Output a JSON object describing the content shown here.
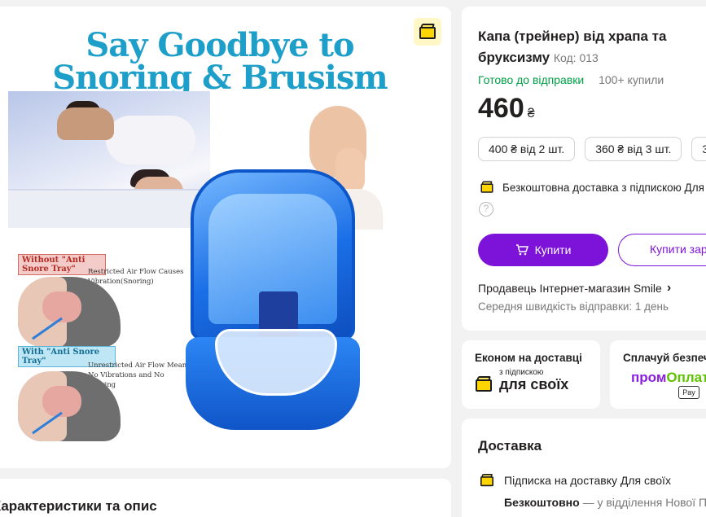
{
  "gallery": {
    "headline_line1": "Say Goodbye to",
    "headline_line2": "Snoring & Brusism",
    "diagram": {
      "without_label": "Without \"Anti Snore Tray\"",
      "without_text": "Restricted Air Flow Causes Vibration(Snoring)",
      "with_label": "With \"Anti Snore Tray\"",
      "with_text": "Unrestricted Air Flow Means No Vibrations and No Snoring"
    },
    "badge_icon": "box-icon"
  },
  "description": {
    "title": "Характеристики та опис"
  },
  "product": {
    "title": "Капа (трейнер) від храпа та бруксизму",
    "code": "Код: 013",
    "stock_status": "Готово до відправки",
    "bought": "100+ купили",
    "price": "460",
    "currency": "₴",
    "tiers": [
      "400 ₴ від 2 шт.",
      "360 ₴ від 3 шт.",
      "3"
    ],
    "free_shipping": "Безкоштовна доставка з підпискою Для своїх",
    "help_symbol": "?",
    "buy_label": "Купити",
    "buy_later_label": "Купити зараз",
    "seller": "Продавець Інтернет-магазин Smile",
    "avg_speed": "Середня швидкість відправки: 1 день"
  },
  "promo": {
    "econom_title": "Економ на доставці",
    "econom_sub": "з підпискою",
    "econom_brand": "для своїх",
    "pay_title": "Сплачуй безпечно",
    "pay_brand_part1": "пром",
    "pay_brand_part2": "Оплата",
    "applepay": "Pay"
  },
  "delivery": {
    "title": "Доставка",
    "subscription": "Підписка на доставку Для своїх",
    "free_label": "Безкоштовно",
    "free_rest": " — у відділення Нової Пошти"
  },
  "colors": {
    "accent": "#7d12d8",
    "in_stock": "#00a046",
    "muted": "#797878",
    "headline": "#1e9fc9"
  }
}
